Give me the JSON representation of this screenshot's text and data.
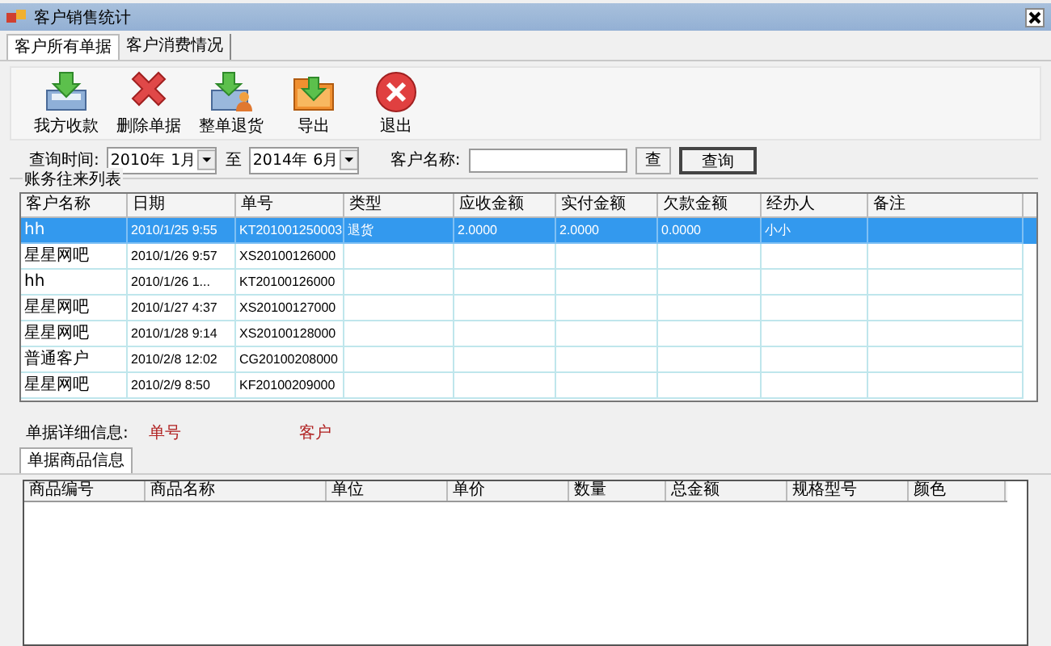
{
  "window": {
    "title": "客户销售统计"
  },
  "tabs": [
    {
      "label": "客户所有单据",
      "selected": true
    },
    {
      "label": "客户消费情况",
      "selected": false
    }
  ],
  "toolbar": [
    {
      "label": "我方收款",
      "kind": "receive"
    },
    {
      "label": "删除单据",
      "kind": "delete"
    },
    {
      "label": "整单退货",
      "kind": "return"
    },
    {
      "label": "导出",
      "kind": "export"
    },
    {
      "label": "退出",
      "kind": "exit"
    }
  ],
  "query": {
    "time_label": "查询时间:",
    "from": "2010年 1月",
    "to_label": "至",
    "to": "2014年 6月",
    "customer_label": "客户名称:",
    "buttons": [
      "查",
      "查询"
    ]
  },
  "list": {
    "title": "账务往来列表",
    "columns": [
      "客户名称",
      "日期",
      "单号",
      "类型",
      "应收金额",
      "实付金额",
      "欠款金额",
      "经办人",
      "备注"
    ],
    "rows": [
      {
        "selected": true,
        "cells": [
          "hh",
          "2010/1/25 9:55",
          "KT201001250003",
          "退货",
          "2.0000",
          "2.0000",
          "0.0000",
          "小小"
        ]
      },
      {
        "selected": false,
        "cells": [
          "星星网吧",
          "2010/1/26 9:57",
          "XS20100126000"
        ]
      },
      {
        "selected": false,
        "cells": [
          "hh",
          "2010/1/26 1...",
          "KT20100126000"
        ]
      },
      {
        "selected": false,
        "cells": [
          "星星网吧",
          "2010/1/27 4:37",
          "XS20100127000"
        ]
      },
      {
        "selected": false,
        "cells": [
          "星星网吧",
          "2010/1/28 9:14",
          "XS20100128000"
        ]
      },
      {
        "selected": false,
        "cells": [
          "普通客户",
          "2010/2/8 12:02",
          "CG20100208000"
        ]
      },
      {
        "selected": false,
        "cells": [
          "星星网吧",
          "2010/2/9 8:50",
          "KF20100209000"
        ]
      }
    ]
  },
  "detail": {
    "label": "单据详细信息:",
    "number_label": "单号",
    "customer_label": "客户"
  },
  "detail_tabs": [
    {
      "label": "单据商品信息",
      "selected": true
    }
  ],
  "goods_table": {
    "columns": [
      "商品编号",
      "商品名称",
      "单位",
      "单价",
      "数量",
      "总金额",
      "规格型号",
      "颜色"
    ]
  }
}
